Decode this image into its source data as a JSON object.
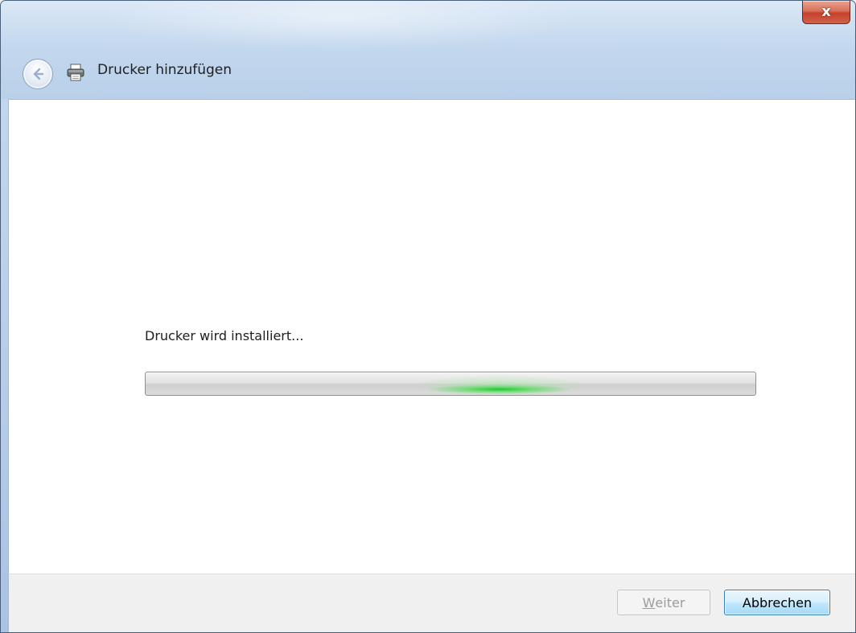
{
  "window": {
    "title": "Drucker hinzufügen",
    "close_label": "x"
  },
  "icons": {
    "back": "back-arrow-icon",
    "printer": "printer-icon",
    "close": "close-icon"
  },
  "main": {
    "status_text": "Drucker wird installiert...",
    "progress": {
      "state": "indeterminate",
      "color": "#1ec83c"
    }
  },
  "footer": {
    "next_label_accel": "W",
    "next_label_rest": "eiter",
    "next_enabled": false,
    "cancel_label": "Abbrechen"
  }
}
